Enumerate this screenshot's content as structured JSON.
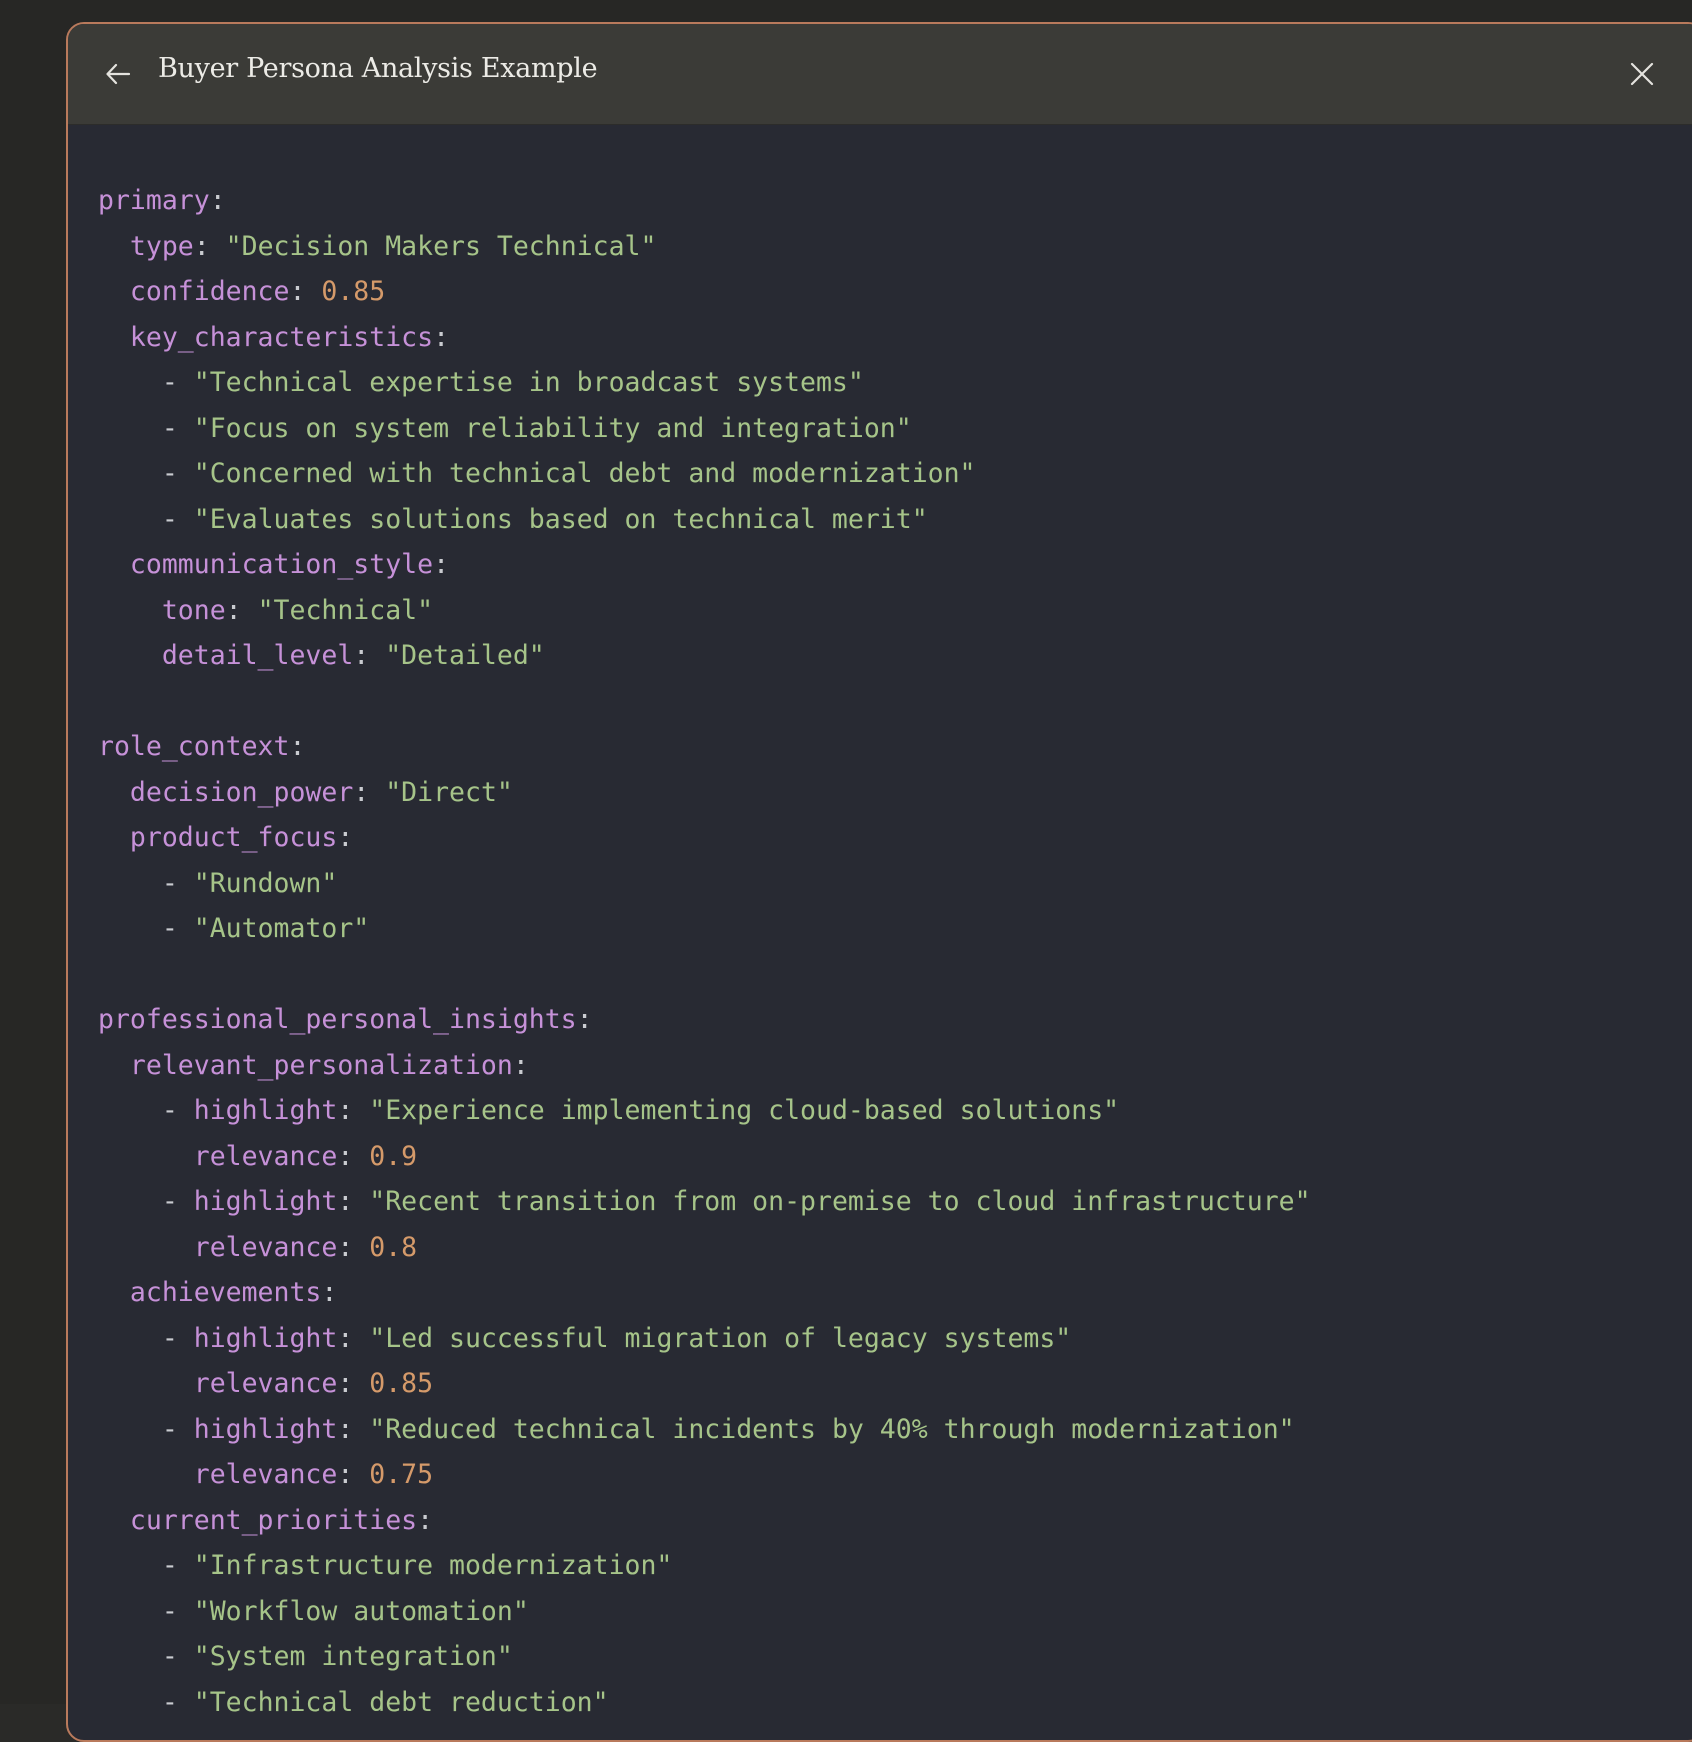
{
  "header": {
    "title": "Buyer Persona Analysis Example",
    "back_icon": "arrow-left-icon",
    "close_icon": "close-icon"
  },
  "colors": {
    "key": "#c691d8",
    "string": "#a6c489",
    "number": "#d59a6a",
    "punctuation": "#c9cbd0",
    "panel_border": "#b97a5c"
  },
  "code_lines": [
    {
      "indent": "",
      "key": "primary",
      "sep": ":",
      "value": "",
      "vtype": ""
    },
    {
      "indent": "  ",
      "key": "type",
      "sep": ": ",
      "value": "\"Decision Makers Technical\"",
      "vtype": "s"
    },
    {
      "indent": "  ",
      "key": "confidence",
      "sep": ": ",
      "value": "0.85",
      "vtype": "n"
    },
    {
      "indent": "  ",
      "key": "key_characteristics",
      "sep": ":",
      "value": "",
      "vtype": ""
    },
    {
      "indent": "    ",
      "dash": "- ",
      "key": "",
      "sep": "",
      "value": "\"Technical expertise in broadcast systems\"",
      "vtype": "s"
    },
    {
      "indent": "    ",
      "dash": "- ",
      "key": "",
      "sep": "",
      "value": "\"Focus on system reliability and integration\"",
      "vtype": "s"
    },
    {
      "indent": "    ",
      "dash": "- ",
      "key": "",
      "sep": "",
      "value": "\"Concerned with technical debt and modernization\"",
      "vtype": "s"
    },
    {
      "indent": "    ",
      "dash": "- ",
      "key": "",
      "sep": "",
      "value": "\"Evaluates solutions based on technical merit\"",
      "vtype": "s"
    },
    {
      "indent": "  ",
      "key": "communication_style",
      "sep": ":",
      "value": "",
      "vtype": ""
    },
    {
      "indent": "    ",
      "key": "tone",
      "sep": ": ",
      "value": "\"Technical\"",
      "vtype": "s"
    },
    {
      "indent": "    ",
      "key": "detail_level",
      "sep": ": ",
      "value": "\"Detailed\"",
      "vtype": "s"
    },
    {
      "indent": "",
      "key": "",
      "sep": "",
      "value": "",
      "vtype": ""
    },
    {
      "indent": "",
      "key": "role_context",
      "sep": ":",
      "value": "",
      "vtype": ""
    },
    {
      "indent": "  ",
      "key": "decision_power",
      "sep": ": ",
      "value": "\"Direct\"",
      "vtype": "s"
    },
    {
      "indent": "  ",
      "key": "product_focus",
      "sep": ":",
      "value": "",
      "vtype": ""
    },
    {
      "indent": "    ",
      "dash": "- ",
      "key": "",
      "sep": "",
      "value": "\"Rundown\"",
      "vtype": "s"
    },
    {
      "indent": "    ",
      "dash": "- ",
      "key": "",
      "sep": "",
      "value": "\"Automator\"",
      "vtype": "s"
    },
    {
      "indent": "",
      "key": "",
      "sep": "",
      "value": "",
      "vtype": ""
    },
    {
      "indent": "",
      "key": "professional_personal_insights",
      "sep": ":",
      "value": "",
      "vtype": ""
    },
    {
      "indent": "  ",
      "key": "relevant_personalization",
      "sep": ":",
      "value": "",
      "vtype": ""
    },
    {
      "indent": "    ",
      "dash": "- ",
      "key": "highlight",
      "sep": ": ",
      "value": "\"Experience implementing cloud-based solutions\"",
      "vtype": "s"
    },
    {
      "indent": "      ",
      "key": "relevance",
      "sep": ": ",
      "value": "0.9",
      "vtype": "n"
    },
    {
      "indent": "    ",
      "dash": "- ",
      "key": "highlight",
      "sep": ": ",
      "value": "\"Recent transition from on-premise to cloud infrastructure\"",
      "vtype": "s"
    },
    {
      "indent": "      ",
      "key": "relevance",
      "sep": ": ",
      "value": "0.8",
      "vtype": "n"
    },
    {
      "indent": "  ",
      "key": "achievements",
      "sep": ":",
      "value": "",
      "vtype": ""
    },
    {
      "indent": "    ",
      "dash": "- ",
      "key": "highlight",
      "sep": ": ",
      "value": "\"Led successful migration of legacy systems\"",
      "vtype": "s"
    },
    {
      "indent": "      ",
      "key": "relevance",
      "sep": ": ",
      "value": "0.85",
      "vtype": "n"
    },
    {
      "indent": "    ",
      "dash": "- ",
      "key": "highlight",
      "sep": ": ",
      "value": "\"Reduced technical incidents by 40% through modernization\"",
      "vtype": "s"
    },
    {
      "indent": "      ",
      "key": "relevance",
      "sep": ": ",
      "value": "0.75",
      "vtype": "n"
    },
    {
      "indent": "  ",
      "key": "current_priorities",
      "sep": ":",
      "value": "",
      "vtype": ""
    },
    {
      "indent": "    ",
      "dash": "- ",
      "key": "",
      "sep": "",
      "value": "\"Infrastructure modernization\"",
      "vtype": "s"
    },
    {
      "indent": "    ",
      "dash": "- ",
      "key": "",
      "sep": "",
      "value": "\"Workflow automation\"",
      "vtype": "s"
    },
    {
      "indent": "    ",
      "dash": "- ",
      "key": "",
      "sep": "",
      "value": "\"System integration\"",
      "vtype": "s"
    },
    {
      "indent": "    ",
      "dash": "- ",
      "key": "",
      "sep": "",
      "value": "\"Technical debt reduction\"",
      "vtype": "s"
    }
  ]
}
